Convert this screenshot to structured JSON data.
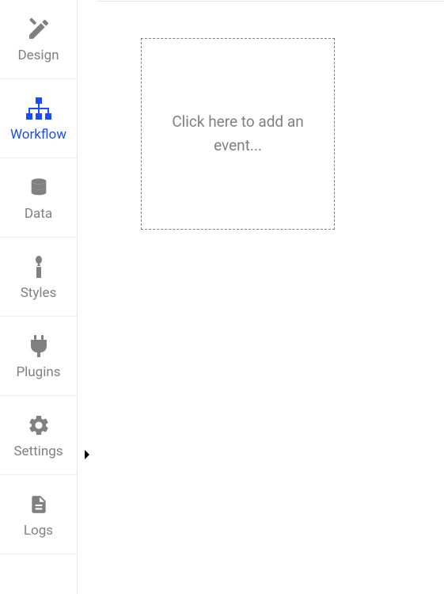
{
  "sidebar": {
    "items": [
      {
        "label": "Design",
        "icon": "design-icon",
        "active": false
      },
      {
        "label": "Workflow",
        "icon": "workflow-icon",
        "active": true
      },
      {
        "label": "Data",
        "icon": "data-icon",
        "active": false
      },
      {
        "label": "Styles",
        "icon": "styles-icon",
        "active": false
      },
      {
        "label": "Plugins",
        "icon": "plugins-icon",
        "active": false
      },
      {
        "label": "Settings",
        "icon": "settings-icon",
        "active": false
      },
      {
        "label": "Logs",
        "icon": "logs-icon",
        "active": false
      }
    ]
  },
  "main": {
    "add_event_label": "Click here to add an event..."
  },
  "colors": {
    "active": "#1a4bff",
    "inactive": "#808080",
    "border": "#e6e6e6"
  }
}
